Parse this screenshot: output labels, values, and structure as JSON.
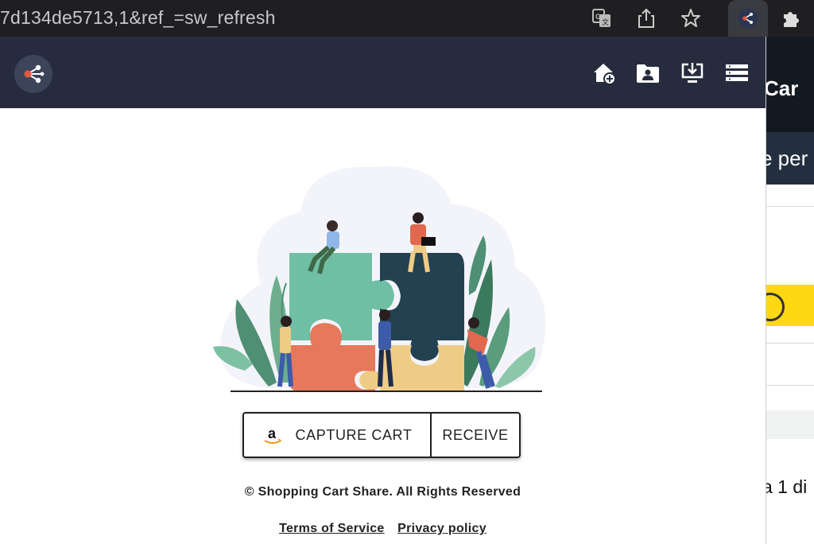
{
  "browser": {
    "url_fragment": "7d134de5713,1&ref_=sw_refresh",
    "icons": [
      "translate-icon",
      "share-icon",
      "star-icon",
      "extension-share-icon",
      "puzzle-icon"
    ]
  },
  "background_page": {
    "brand_fragment": "Car",
    "banner_fragment": "e per",
    "text_fragment": "a 1 di"
  },
  "popup": {
    "header": {
      "logo_icon": "share-nodes-icon",
      "actions": [
        {
          "icon": "home-add-icon"
        },
        {
          "icon": "folder-user-icon"
        },
        {
          "icon": "download-icon"
        },
        {
          "icon": "list-icon"
        }
      ]
    },
    "illustration": "puzzle-team-illustration",
    "buttons": {
      "capture_label": "CAPTURE CART",
      "receive_label": "RECEIVE"
    },
    "footer": {
      "copyright": "© Shopping Cart Share. All Rights Reserved",
      "terms": "Terms of Service",
      "privacy": "Privacy policy"
    }
  },
  "colors": {
    "header_bg": "#262c3d",
    "accent_red": "#e8573f",
    "puzzle_green": "#6fbfa5",
    "puzzle_navy": "#234150",
    "puzzle_coral": "#e6785c",
    "puzzle_yellow": "#efcc86"
  }
}
